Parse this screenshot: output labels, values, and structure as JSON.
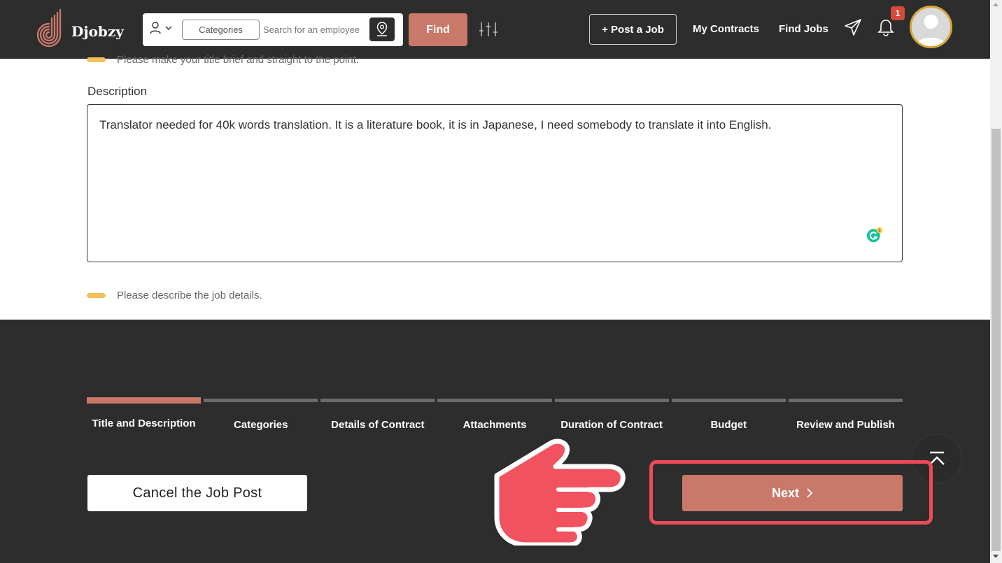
{
  "app": {
    "name": "Djobzy"
  },
  "header": {
    "categories_label": "Categories",
    "search_placeholder": "Search for an employee",
    "find_label": "Find",
    "post_job_label": "+ Post a Job",
    "my_contracts_label": "My Contracts",
    "find_jobs_label": "Find Jobs",
    "notification_count": "1"
  },
  "form": {
    "title_hint": "Please make your title brief and straight to the point.",
    "description_label": "Description",
    "description_value": "Translator needed for 40k words translation. It is a literature book, it is in Japanese, I need somebody to translate it into English.",
    "grammarly_count": "1",
    "description_hint": "Please describe the job details."
  },
  "steps": [
    {
      "label": "Title and Description",
      "active": true
    },
    {
      "label": "Categories",
      "active": false
    },
    {
      "label": "Details of Contract",
      "active": false
    },
    {
      "label": "Attachments",
      "active": false
    },
    {
      "label": "Duration of Contract",
      "active": false
    },
    {
      "label": "Budget",
      "active": false
    },
    {
      "label": "Review and Publish",
      "active": false
    }
  ],
  "actions": {
    "cancel_label": "Cancel the Job Post",
    "next_label": "Next"
  },
  "colors": {
    "accent": "#c9786a",
    "dark": "#2d2d2d",
    "highlight": "#ef4a57",
    "hint": "#f0c05a"
  }
}
